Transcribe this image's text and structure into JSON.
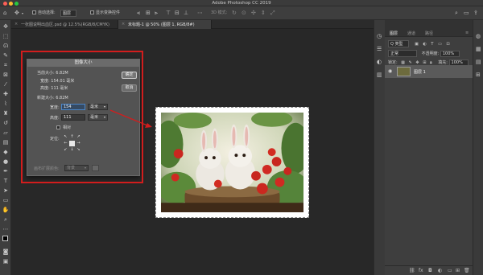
{
  "app": {
    "title": "Adobe Photoshop CC 2019"
  },
  "options_bar": {
    "auto_select_label": "自动选择:",
    "auto_select_value": "图层",
    "show_transform_label": "显示变换控件",
    "mode_3d_label": "3D 模式:"
  },
  "tabs": [
    {
      "label": "一张图说明出血区.psd @ 12.5%(RGB/8/CMYK)"
    },
    {
      "label": "未标题-1 @ 50% (图层 1, RGB/8#)"
    }
  ],
  "dialog": {
    "title": "图像大小",
    "current_size_label": "当前大小: 6.82M",
    "current_width": "宽度:  154.01 毫米",
    "current_height": "高度:  111 毫米",
    "new_size_label": "新建大小: 6.82M",
    "width_label": "宽度:",
    "width_value": "154",
    "width_unit": "毫米",
    "height_label": "高度:",
    "height_value": "111",
    "height_unit": "毫米",
    "relative_label": "相对",
    "anchor_label": "定位:",
    "canvas_ext_label": "画布扩展颜色:",
    "canvas_ext_value": "背景",
    "ok_label": "确定",
    "cancel_label": "取消"
  },
  "layers_panel": {
    "tabs": [
      "图层",
      "通道",
      "路径"
    ],
    "filter_label": "Q 类型",
    "blend_mode": "正常",
    "opacity_label": "不透明度:",
    "opacity_value": "100%",
    "lock_label": "锁定:",
    "fill_label": "填充:",
    "fill_value": "100%",
    "layer_name": "图层 1"
  },
  "colors": {
    "highlight": "#d21d1d",
    "panel_bg": "#3e3e3e",
    "canvas_bg": "#282828"
  }
}
